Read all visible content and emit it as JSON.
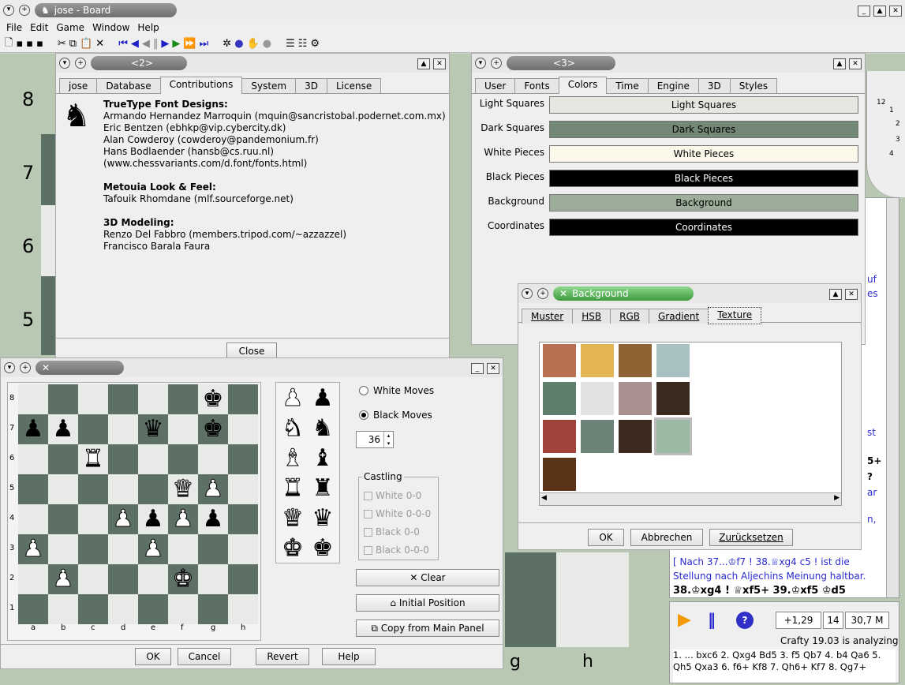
{
  "main": {
    "title": "jose - Board",
    "menu": [
      "File",
      "Edit",
      "Game",
      "Window",
      "Help"
    ]
  },
  "win2": {
    "title": "<2>",
    "tabs": [
      "jose",
      "Database",
      "Contributions",
      "System",
      "3D",
      "License"
    ],
    "active": 2,
    "sections": [
      {
        "heading": "TrueType Font Designs:",
        "lines": [
          "Armando Hernandez Marroquin (mquin@sancristobal.podernet.com.mx)",
          "Eric Bentzen (ebhkp@vip.cybercity.dk)",
          "Alan Cowderoy (cowderoy@pandemonium.fr)",
          "Hans Bodlaender (hansb@cs.ruu.nl)",
          "(www.chessvariants.com/d.font/fonts.html)"
        ]
      },
      {
        "heading": "Metouia Look & Feel:",
        "lines": [
          "Tafouik Rhomdane (mlf.sourceforge.net)"
        ]
      },
      {
        "heading": "3D Modeling:",
        "lines": [
          "Renzo Del Fabbro (members.tripod.com/~azzazzel)",
          "Francisco Barala Faura"
        ]
      }
    ],
    "close": "Close"
  },
  "win3": {
    "title": "<3>",
    "tabs": [
      "User",
      "Fonts",
      "Colors",
      "Time",
      "Engine",
      "3D",
      "Styles"
    ],
    "active": 2,
    "rows": [
      {
        "label": "Light Squares",
        "value": "Light Squares",
        "color": "#e7e7e2",
        "text": "#000"
      },
      {
        "label": "Dark Squares",
        "value": "Dark Squares",
        "color": "#748878",
        "text": "#000"
      },
      {
        "label": "White Pieces",
        "value": "White Pieces",
        "color": "#fbf8ea",
        "text": "#000"
      },
      {
        "label": "Black Pieces",
        "value": "Black Pieces",
        "color": "#000000",
        "text": "#fff"
      },
      {
        "label": "Background",
        "value": "Background",
        "color": "#9cae9a",
        "text": "#000"
      },
      {
        "label": "Coordinates",
        "value": "Coordinates",
        "color": "#000000",
        "text": "#fff"
      }
    ]
  },
  "bgdlg": {
    "title": "Background",
    "tabs": [
      "Muster",
      "HSB",
      "RGB",
      "Gradient",
      "Texture"
    ],
    "active": 4,
    "textures": [
      "#b86f52",
      "#e3b553",
      "#8f6434",
      "#a9c0c3",
      "#5f7f6d",
      "#e2e2e2",
      "#a7908d",
      "#3a2a20",
      "#a0433a",
      "#6d8378",
      "#3d2a1f",
      "#9bb9a3",
      "#5b3418"
    ],
    "ok": "OK",
    "cancel": "Abbrechen",
    "reset": "Zurücksetzen"
  },
  "setup": {
    "ranks": [
      "8",
      "7",
      "6",
      "5",
      "4",
      "3",
      "2",
      "1"
    ],
    "files": [
      "a",
      "b",
      "c",
      "d",
      "e",
      "f",
      "g",
      "h"
    ],
    "white_moves": "White Moves",
    "black_moves": "Black Moves",
    "move_no": "36",
    "castling": "Castling",
    "castles": [
      "White 0-0",
      "White 0-0-0",
      "Black 0-0",
      "Black 0-0-0"
    ],
    "clear": "Clear",
    "initial": "Initial Position",
    "copy": "Copy from Main Panel",
    "ok": "OK",
    "cancel": "Cancel",
    "revert": "Revert",
    "help": "Help"
  },
  "main_board": {
    "ranks": [
      "8",
      "7",
      "6",
      "5"
    ],
    "files": [
      "g",
      "h"
    ]
  },
  "notation": {
    "lines": [
      "[ Nach 37...♔f7 ! 38.♕xg4 c5 ! ist die",
      "Stellung nach Aljechins Meinung haltbar.",
      "38.♔xg4 ! ♕xf5+ 39.♔xf5 ♔d5"
    ],
    "fragments": [
      "uf",
      "es",
      "st",
      "5+",
      "?",
      "ar",
      "n,"
    ]
  },
  "engine": {
    "eval": "+1,29",
    "depth": "14",
    "nodes": "30,7 M",
    "status": "Crafty 19.03  is analyzing",
    "pv": "1. ... bxc6 2. Qxg4 Bd5 3. f5 Qb7 4. b4 Qa6 5. Qh5 Qxa3 6. f6+ Kf8 7. Qh6+ Kf7 8. Qg7+",
    "clock": [
      "12",
      "1",
      "2",
      "3",
      "4"
    ]
  }
}
